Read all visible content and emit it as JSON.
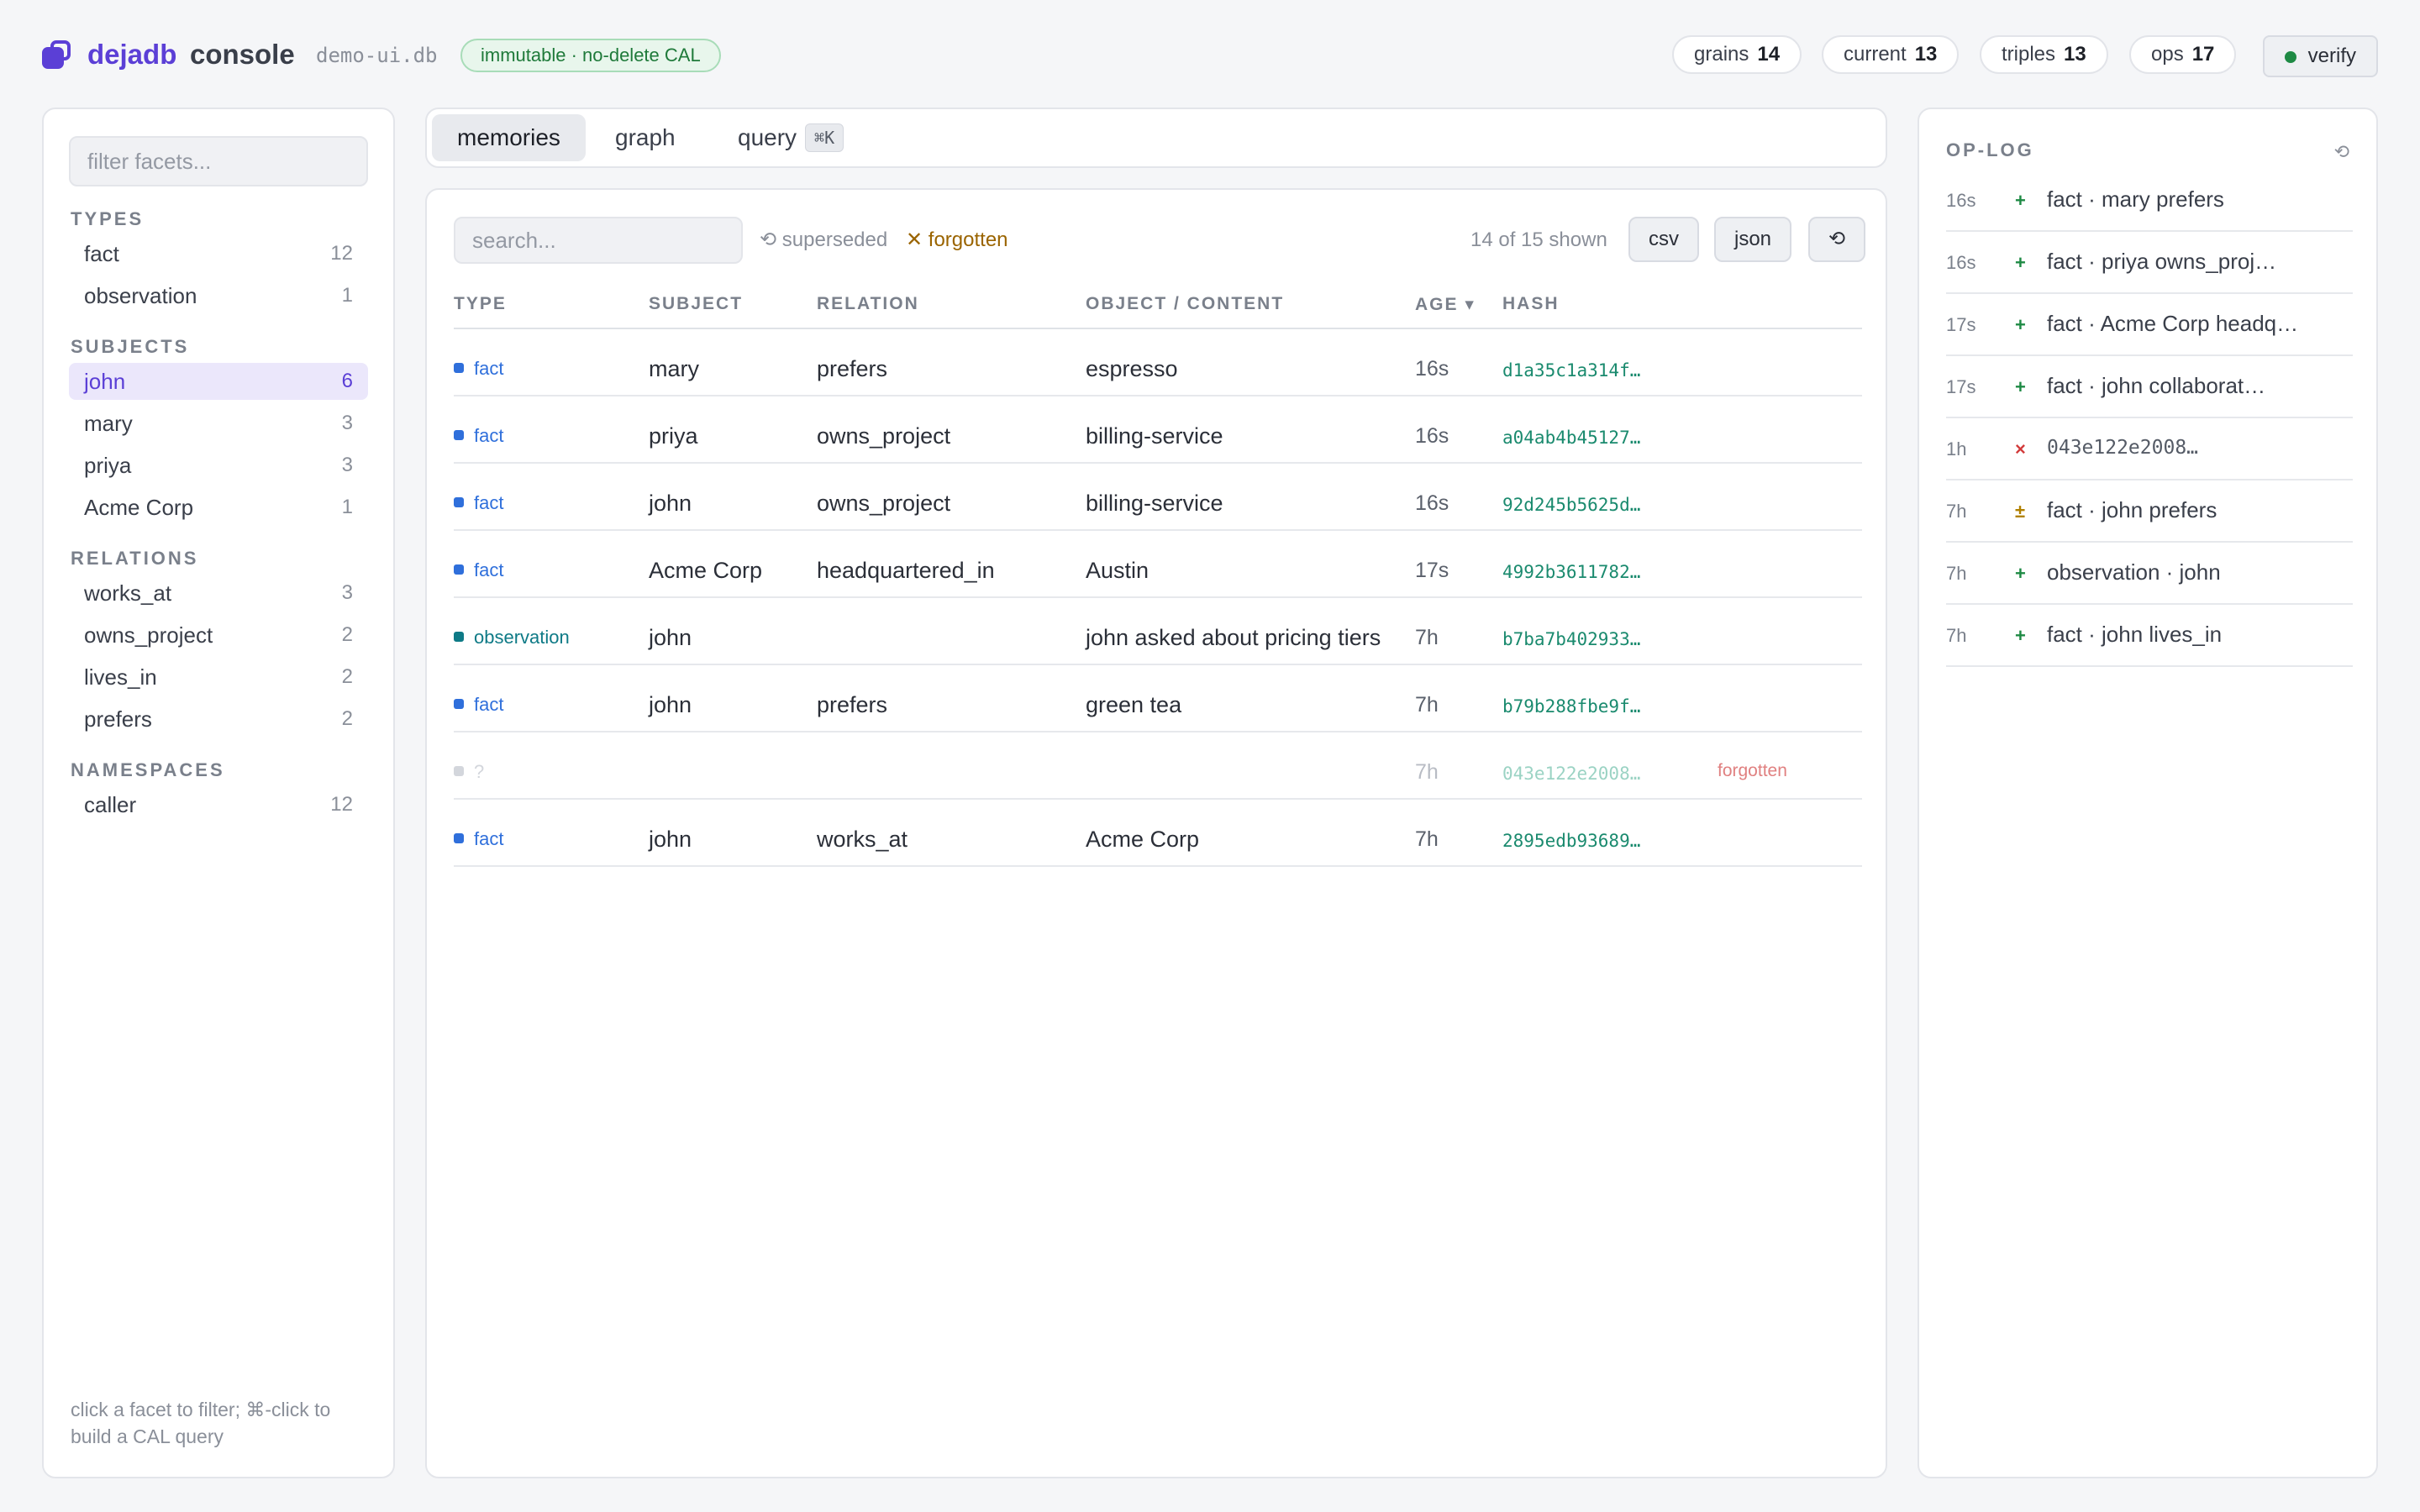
{
  "header": {
    "brand": "dejadb",
    "brand_sub": "console",
    "db_name": "demo-ui.db",
    "badge": "immutable · no-delete CAL",
    "stats": [
      {
        "label": "grains",
        "value": "14"
      },
      {
        "label": "current",
        "value": "13"
      },
      {
        "label": "triples",
        "value": "13"
      },
      {
        "label": "ops",
        "value": "17"
      }
    ],
    "verify_label": "verify",
    "colors": {
      "brand": "#5b3fd6",
      "verify_dot": "#1e8a44"
    }
  },
  "sidebar": {
    "filter_placeholder": "filter facets...",
    "sections": [
      {
        "title": "TYPES",
        "items": [
          {
            "label": "fact",
            "count": "12"
          },
          {
            "label": "observation",
            "count": "1"
          }
        ]
      },
      {
        "title": "SUBJECTS",
        "items": [
          {
            "label": "john",
            "count": "6",
            "active": true
          },
          {
            "label": "mary",
            "count": "3"
          },
          {
            "label": "priya",
            "count": "3"
          },
          {
            "label": "Acme Corp",
            "count": "1"
          }
        ]
      },
      {
        "title": "RELATIONS",
        "items": [
          {
            "label": "works_at",
            "count": "3"
          },
          {
            "label": "owns_project",
            "count": "2"
          },
          {
            "label": "lives_in",
            "count": "2"
          },
          {
            "label": "prefers",
            "count": "2"
          }
        ]
      },
      {
        "title": "NAMESPACES",
        "items": [
          {
            "label": "caller",
            "count": "12"
          }
        ]
      }
    ],
    "footer": "click a facet to filter; ⌘-click to build a CAL query"
  },
  "tabs": {
    "items": [
      "memories",
      "graph",
      "query"
    ],
    "active": "memories",
    "query_shortcut": "⌘K"
  },
  "main": {
    "search_placeholder": "search...",
    "toggle_superseded": "⟲ superseded",
    "toggle_forgotten": "✕ forgotten",
    "shown": "14 of 15 shown",
    "buttons": {
      "csv": "csv",
      "json": "json",
      "refresh": "⟲"
    },
    "columns": [
      "TYPE",
      "SUBJECT",
      "RELATION",
      "OBJECT / CONTENT",
      "AGE ▾",
      "HASH"
    ],
    "rows": [
      {
        "type": "fact",
        "subject": "mary",
        "relation": "prefers",
        "object": "espresso",
        "age": "16s",
        "hash": "d1a35c1a314f…"
      },
      {
        "type": "fact",
        "subject": "priya",
        "relation": "owns_project",
        "object": "billing-service",
        "age": "16s",
        "hash": "a04ab4b45127…"
      },
      {
        "type": "fact",
        "subject": "john",
        "relation": "owns_project",
        "object": "billing-service",
        "age": "16s",
        "hash": "92d245b5625d…"
      },
      {
        "type": "fact",
        "subject": "Acme Corp",
        "relation": "headquartered_in",
        "object": "Austin",
        "age": "17s",
        "hash": "4992b3611782…"
      },
      {
        "type": "observation",
        "subject": "john",
        "relation": "",
        "object": "john asked about pricing tiers",
        "age": "7h",
        "hash": "b7ba7b402933…"
      },
      {
        "type": "fact",
        "subject": "john",
        "relation": "prefers",
        "object": "green tea",
        "age": "7h",
        "hash": "b79b288fbe9f…"
      },
      {
        "type": "?",
        "subject": "",
        "relation": "",
        "object": "",
        "age": "7h",
        "hash": "043e122e2008…",
        "status": "forgotten"
      },
      {
        "type": "fact",
        "subject": "john",
        "relation": "works_at",
        "object": "Acme Corp",
        "age": "7h",
        "hash": "2895edb93689…"
      }
    ],
    "colors": {
      "fact": "#2f6fdb",
      "observation": "#0e7a86",
      "ghost": "#d3d6dc",
      "hash": "#1a8a6e"
    }
  },
  "oplog": {
    "title": "OP-LOG",
    "refresh": "⟲",
    "entries": [
      {
        "age": "16s",
        "sym": "+",
        "text": "fact · mary prefers"
      },
      {
        "age": "16s",
        "sym": "+",
        "text": "fact · priya owns_proj…"
      },
      {
        "age": "17s",
        "sym": "+",
        "text": "fact · Acme Corp headq…"
      },
      {
        "age": "17s",
        "sym": "+",
        "text": "fact · john collaborat…"
      },
      {
        "age": "1h",
        "sym": "×",
        "text": "043e122e2008…",
        "mono": true
      },
      {
        "age": "7h",
        "sym": "±",
        "text": "fact · john prefers"
      },
      {
        "age": "7h",
        "sym": "+",
        "text": "observation · john"
      },
      {
        "age": "7h",
        "sym": "+",
        "text": "fact · john lives_in"
      }
    ],
    "sym_colors": {
      "+": "#1e8a44",
      "×": "#d23b3b",
      "±": "#b08000"
    }
  }
}
